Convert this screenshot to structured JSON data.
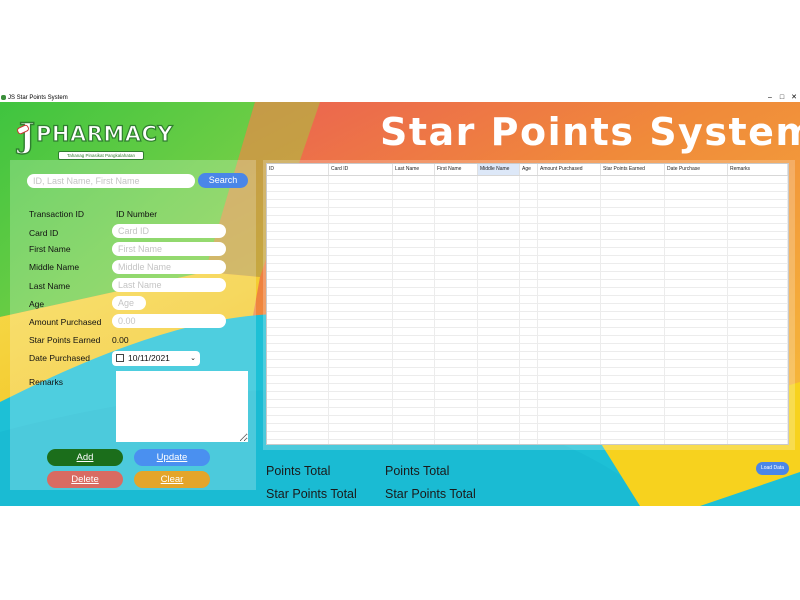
{
  "window": {
    "title": "JS Star Points System",
    "controls": [
      "minimize",
      "maximize",
      "close"
    ]
  },
  "header": {
    "logo_letter": "J",
    "logo_text": "PHARMACY",
    "logo_tagline": "Tahanag Pinasikat Pangkalahatan",
    "title": "Star Points System"
  },
  "search": {
    "placeholder": "ID, Last Name, First Name",
    "button_label": "Search"
  },
  "form": {
    "transaction_id_label": "Transaction ID",
    "transaction_id_value": "ID Number",
    "card_id_label": "Card ID",
    "card_id_placeholder": "Card ID",
    "first_name_label": "First Name",
    "first_name_placeholder": "First Name",
    "middle_name_label": "Middle Name",
    "middle_name_placeholder": "Middle Name",
    "last_name_label": "Last Name",
    "last_name_placeholder": "Last Name",
    "age_label": "Age",
    "age_placeholder": "Age",
    "amount_label": "Amount Purchased",
    "amount_placeholder": "0.00",
    "star_points_label": "Star Points Earned",
    "star_points_value": "0.00",
    "date_label": "Date Purchased",
    "date_value": "10/11/2021",
    "remarks_label": "Remarks"
  },
  "buttons": {
    "add": "Add",
    "update": "Update",
    "delete": "Delete",
    "clear": "Clear",
    "load_data": "Load Data"
  },
  "table": {
    "columns": [
      "ID",
      "Card ID",
      "Last Name",
      "First Name",
      "Middle Name",
      "Age",
      "Amount Purchased",
      "Star Points Earned",
      "Date Purchase",
      "Remarks"
    ],
    "selected_column": "Middle Name",
    "rows": []
  },
  "totals": {
    "points_total_label": "Points Total",
    "points_total_value": "Points Total",
    "star_points_total_label": "Star Points Total",
    "star_points_total_value": "Star Points Total"
  },
  "colors": {
    "green": "#3cc53c",
    "orange": "#f0a03c",
    "yellow": "#f7d02c",
    "cyan": "#1cc4d8",
    "accent_blue": "#4a86e8"
  }
}
